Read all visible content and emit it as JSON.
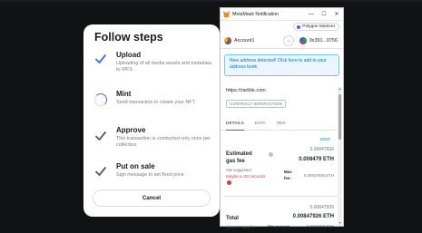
{
  "modal": {
    "title": "Follow steps",
    "steps": [
      {
        "title": "Upload",
        "desc": "Uploading of all media assets and metadata to IPFS",
        "state": "done"
      },
      {
        "title": "Mint",
        "desc": "Send transaction to create your NFT",
        "state": "loading"
      },
      {
        "title": "Approve",
        "desc": "This transaction is conducted only once per collection",
        "state": "pending"
      },
      {
        "title": "Put on sale",
        "desc": "Sign message to set fixed price",
        "state": "pending"
      }
    ],
    "cancel_label": "Cancel",
    "colors": {
      "done": "#3b6fe0",
      "pending": "#5a5a5a"
    }
  },
  "metamask": {
    "window_title": "MetaMask Notification",
    "controls": {
      "minimize": "—",
      "maximize": "☐",
      "close": "✕"
    },
    "network": "Polygon Mainnet",
    "account_from": "Account1",
    "account_to": "0x391...0756",
    "notice": "New address detected! Click here to add to your address book.",
    "origin": "https://rarible.com",
    "contract_tag": "CONTRACT INTERACTION",
    "tabs": [
      "DETAILS",
      "DATA",
      "HEX"
    ],
    "edit_label": "EDIT",
    "gas": {
      "label": "Estimated gas fee",
      "value_small": "0.00847926",
      "value_bold": "0.008479 ETH",
      "site_suggested": "Site suggested",
      "maybe": "Maybe in 30 seconds",
      "max_fee_label": "Max fee:",
      "max_fee_value": "0.00847926 ETH"
    },
    "total": {
      "label": "Total",
      "value_small": "0.00847926",
      "value_bold": "0.00847926 ETH",
      "amount_gas": "Amount + gas fee",
      "max_amount_label": "Max amount:",
      "max_amount_value": "0.00847926 ETH"
    }
  }
}
